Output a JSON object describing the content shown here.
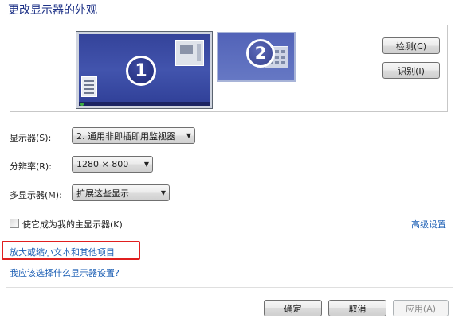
{
  "page": {
    "title": "更改显示器的外观"
  },
  "preview": {
    "monitor1_number": "1",
    "monitor2_number": "2"
  },
  "buttons": {
    "detect": "检测(C)",
    "identify": "识别(I)",
    "ok": "确定",
    "cancel": "取消",
    "apply": "应用(A)"
  },
  "settings": {
    "display_label": "显示器(S):",
    "display_value": "2. 通用非即插即用监视器",
    "resolution_label": "分辨率(R):",
    "resolution_value": "1280 × 800",
    "multi_label": "多显示器(M):",
    "multi_value": "扩展这些显示"
  },
  "checkbox": {
    "main_display_label": "使它成为我的主显示器(K)",
    "checked": false
  },
  "links": {
    "advanced": "高级设置",
    "text_size": "放大或缩小文本和其他项目",
    "which_settings": "我应该选择什么显示器设置?"
  },
  "colors": {
    "link": "#1c5fb5",
    "title": "#1e3287",
    "highlight_box": "#e01f1f"
  }
}
